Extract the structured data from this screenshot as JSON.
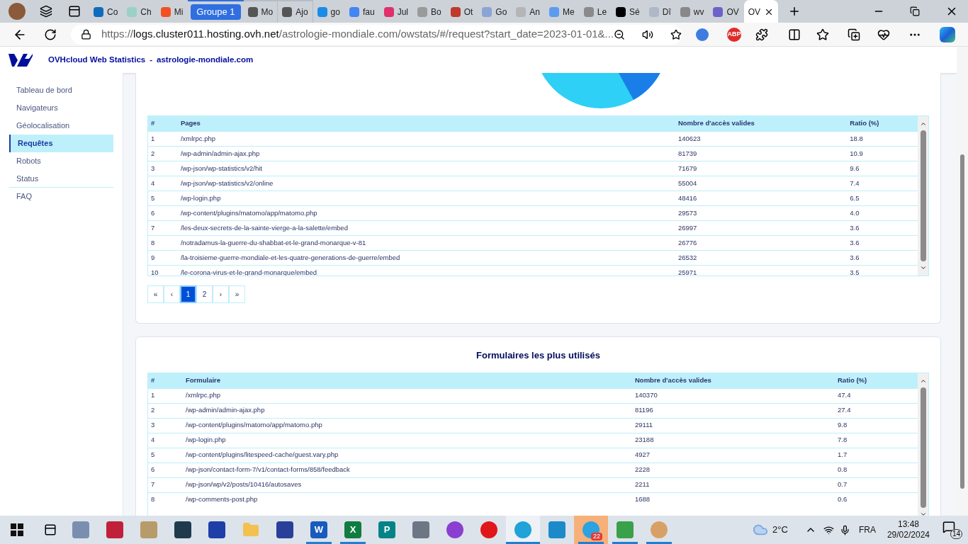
{
  "browser": {
    "tabs": [
      {
        "kind": "tab",
        "title": "Co",
        "color": "#0f6cbd",
        "in_group": false,
        "selected": false
      },
      {
        "kind": "tab",
        "title": "Ch",
        "color": "#9ad1c5",
        "in_group": false,
        "selected": false
      },
      {
        "kind": "tab",
        "title": "Mi",
        "color": "#f25022",
        "in_group": false,
        "selected": false
      },
      {
        "kind": "group",
        "title": "Groupe 1",
        "in_group": true
      },
      {
        "kind": "tab",
        "title": "Mo",
        "color": "#555555",
        "in_group": true,
        "selected": false
      },
      {
        "kind": "tab",
        "title": "Ajo",
        "color": "#555555",
        "in_group": true,
        "selected": false
      },
      {
        "kind": "tab",
        "title": "go",
        "color": "#1a8ce8",
        "in_group": false,
        "selected": false
      },
      {
        "kind": "tab",
        "title": "fau",
        "color": "#4285f4",
        "in_group": false,
        "selected": false
      },
      {
        "kind": "tab",
        "title": "Jul",
        "color": "#e1306c",
        "in_group": false,
        "selected": false
      },
      {
        "kind": "tab",
        "title": "Bo",
        "color": "#9a9a9a",
        "in_group": false,
        "selected": false
      },
      {
        "kind": "tab",
        "title": "Ot",
        "color": "#c0392b",
        "in_group": false,
        "selected": false
      },
      {
        "kind": "tab",
        "title": "Go",
        "color": "#8aa4d6",
        "in_group": false,
        "selected": false
      },
      {
        "kind": "tab",
        "title": "An",
        "color": "#b5b5b5",
        "in_group": false,
        "selected": false
      },
      {
        "kind": "tab",
        "title": "Me",
        "color": "#5b9bf0",
        "in_group": false,
        "selected": false
      },
      {
        "kind": "tab",
        "title": "Le",
        "color": "#8a8a8a",
        "in_group": false,
        "selected": false
      },
      {
        "kind": "tab",
        "title": "Sé",
        "color": "#000000",
        "in_group": false,
        "selected": false
      },
      {
        "kind": "tab",
        "title": "Dî",
        "color": "#b0b8c8",
        "in_group": false,
        "selected": false
      },
      {
        "kind": "tab",
        "title": "wv",
        "color": "#888888",
        "in_group": false,
        "selected": false
      },
      {
        "kind": "tab",
        "title": "OV",
        "color": "#6b63c8",
        "in_group": false,
        "selected": false
      },
      {
        "kind": "tab",
        "title": "OV",
        "in_group": false,
        "selected": true
      }
    ],
    "address": {
      "scheme": "https://",
      "host": "logs.cluster011.hosting.ovh.net",
      "path": "/astrologie-mondiale.com/owstats/#/request?start_date=2023-01-01&..."
    },
    "extension_badge": "ABP"
  },
  "header": {
    "title": "OVHcloud Web Statistics",
    "separator": "-",
    "site": "astrologie-mondiale.com"
  },
  "sidebar": {
    "items": [
      {
        "label": "Tableau de bord",
        "selected": false,
        "divider_after": false
      },
      {
        "label": "Navigateurs",
        "selected": false,
        "divider_after": false
      },
      {
        "label": "Géolocalisation",
        "selected": false,
        "divider_after": false
      },
      {
        "label": "Requêtes",
        "selected": true,
        "divider_after": false
      },
      {
        "label": "Robots",
        "selected": false,
        "divider_after": false
      },
      {
        "label": "Status",
        "selected": false,
        "divider_after": true
      },
      {
        "label": "FAQ",
        "selected": false,
        "divider_after": false
      }
    ]
  },
  "pages_table": {
    "columns": [
      "#",
      "Pages",
      "Nombre d'accès valides",
      "Ratio (%)"
    ],
    "rows": [
      [
        "1",
        "/xmlrpc.php",
        "140623",
        "18.8"
      ],
      [
        "2",
        "/wp-admin/admin-ajax.php",
        "81739",
        "10.9"
      ],
      [
        "3",
        "/wp-json/wp-statistics/v2/hit",
        "71679",
        "9.6"
      ],
      [
        "4",
        "/wp-json/wp-statistics/v2/online",
        "55004",
        "7.4"
      ],
      [
        "5",
        "/wp-login.php",
        "48416",
        "6.5"
      ],
      [
        "6",
        "/wp-content/plugins/matomo/app/matomo.php",
        "29573",
        "4.0"
      ],
      [
        "7",
        "/les-deux-secrets-de-la-sainte-vierge-a-la-salette/embed",
        "26997",
        "3.6"
      ],
      [
        "8",
        "/notradamus-la-guerre-du-shabbat-et-le-grand-monarque-v-81",
        "26776",
        "3.6"
      ],
      [
        "9",
        "/la-troisieme-guerre-mondiale-et-les-quatre-generations-de-guerre/embed",
        "26532",
        "3.6"
      ],
      [
        "10",
        "/le-corona-virus-et-le-grand-monarque/embed",
        "25971",
        "3.5"
      ]
    ]
  },
  "pagination": [
    {
      "label": "«",
      "selected": false
    },
    {
      "label": "‹",
      "selected": false
    },
    {
      "label": "1",
      "selected": true
    },
    {
      "label": "2",
      "selected": false
    },
    {
      "label": "›",
      "selected": false
    },
    {
      "label": "»",
      "selected": false
    }
  ],
  "forms_section": {
    "title": "Formulaires les plus utilisés",
    "table": {
      "columns": [
        "#",
        "Formulaire",
        "Nombre d'accès valides",
        "Ratio (%)"
      ],
      "rows": [
        [
          "1",
          "/xmlrpc.php",
          "140370",
          "47.4"
        ],
        [
          "2",
          "/wp-admin/admin-ajax.php",
          "81196",
          "27.4"
        ],
        [
          "3",
          "/wp-content/plugins/matomo/app/matomo.php",
          "29111",
          "9.8"
        ],
        [
          "4",
          "/wp-login.php",
          "23188",
          "7.8"
        ],
        [
          "5",
          "/wp-content/plugins/litespeed-cache/guest.vary.php",
          "4927",
          "1.7"
        ],
        [
          "6",
          "/wp-json/contact-form-7/v1/contact-forms/858/feedback",
          "2228",
          "0.8"
        ],
        [
          "7",
          "/wp-json/wp/v2/posts/10416/autosaves",
          "2211",
          "0.7"
        ],
        [
          "8",
          "/wp-comments-post.php",
          "1688",
          "0.6"
        ]
      ]
    }
  },
  "taskbar": {
    "apps": [
      {
        "kind": "app",
        "color": "#7a8fb0",
        "open": false,
        "selected": false
      },
      {
        "kind": "app",
        "color": "#c0203a",
        "open": false,
        "selected": false
      },
      {
        "kind": "app",
        "color": "#b89b6a",
        "open": false,
        "selected": false
      },
      {
        "kind": "app",
        "color": "#1f3a4d",
        "open": false,
        "selected": false
      },
      {
        "kind": "app",
        "color": "#1e3fa8",
        "open": false,
        "selected": false
      },
      {
        "kind": "folder",
        "color": "#f2c14e",
        "open": false,
        "selected": false
      },
      {
        "kind": "app",
        "color": "#2a3f9a",
        "open": false,
        "selected": false
      },
      {
        "kind": "letter",
        "label": "W",
        "color": "#185abd",
        "open": true,
        "selected": false
      },
      {
        "kind": "letter",
        "label": "X",
        "color": "#107c41",
        "open": true,
        "selected": false
      },
      {
        "kind": "letter",
        "label": "P",
        "color": "#038387",
        "open": false,
        "selected": false
      },
      {
        "kind": "app",
        "color": "#6b7785",
        "open": false,
        "selected": false
      },
      {
        "kind": "round",
        "color": "#8b3fd1",
        "open": false,
        "selected": false
      },
      {
        "kind": "round",
        "color": "#e0161b",
        "open": false,
        "selected": false
      },
      {
        "kind": "round",
        "color": "#1fa3d8",
        "open": true,
        "selected": true
      },
      {
        "kind": "app",
        "color": "#1c8ac9",
        "open": false,
        "selected": false
      },
      {
        "kind": "round",
        "color": "#2aa3e0",
        "open": true,
        "selected": false,
        "flashing": true,
        "badge": "22"
      },
      {
        "kind": "app",
        "color": "#3aa04a",
        "open": true,
        "selected": false
      },
      {
        "kind": "round",
        "color": "#d9a066",
        "open": true,
        "selected": false
      }
    ],
    "weather": "2°C",
    "language": "FRA",
    "time": "13:48",
    "date": "29/02/2024",
    "notifications": "14"
  }
}
